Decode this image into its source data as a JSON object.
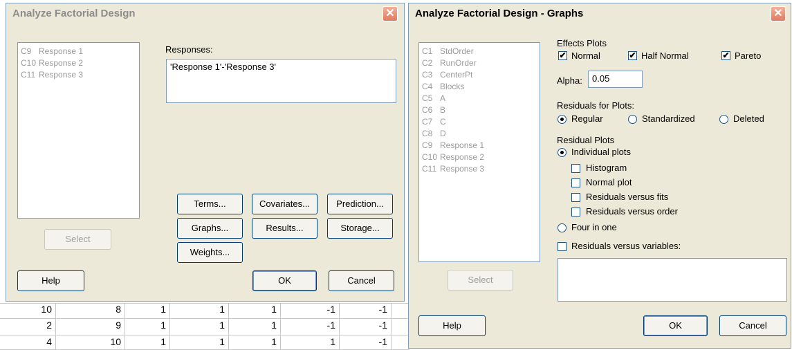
{
  "background_grid": {
    "rows": [
      [
        "10",
        "8",
        "1",
        "1",
        "1",
        "-1",
        "-1"
      ],
      [
        "2",
        "9",
        "1",
        "1",
        "1",
        "-1",
        "-1"
      ],
      [
        "4",
        "10",
        "1",
        "1",
        "1",
        "1",
        "-1"
      ]
    ]
  },
  "dialog1": {
    "title": "Analyze Factorial Design",
    "close_glyph": "✕",
    "columns": [
      {
        "id": "C9",
        "name": "Response 1"
      },
      {
        "id": "C10",
        "name": "Response 2"
      },
      {
        "id": "C11",
        "name": "Response 3"
      }
    ],
    "responses_label": "Responses:",
    "responses_value": "'Response 1'-'Response 3'",
    "select_label": "Select",
    "buttons": {
      "terms": "Terms...",
      "covariates": "Covariates...",
      "prediction": "Prediction...",
      "graphs": "Graphs...",
      "results": "Results...",
      "storage": "Storage...",
      "weights": "Weights...",
      "help": "Help",
      "ok": "OK",
      "cancel": "Cancel"
    }
  },
  "dialog2": {
    "title": "Analyze Factorial Design - Graphs",
    "close_glyph": "✕",
    "columns": [
      {
        "id": "C1",
        "name": "StdOrder"
      },
      {
        "id": "C2",
        "name": "RunOrder"
      },
      {
        "id": "C3",
        "name": "CenterPt"
      },
      {
        "id": "C4",
        "name": "Blocks"
      },
      {
        "id": "C5",
        "name": "A"
      },
      {
        "id": "C6",
        "name": "B"
      },
      {
        "id": "C7",
        "name": "C"
      },
      {
        "id": "C8",
        "name": "D"
      },
      {
        "id": "C9",
        "name": "Response 1"
      },
      {
        "id": "C10",
        "name": "Response 2"
      },
      {
        "id": "C11",
        "name": "Response 3"
      }
    ],
    "effects_plots_label": "Effects Plots",
    "normal_label": "Normal",
    "normal_checked": true,
    "half_normal_label": "Half Normal",
    "half_normal_checked": true,
    "pareto_label": "Pareto",
    "pareto_checked": true,
    "alpha_label": "Alpha:",
    "alpha_value": "0.05",
    "residuals_for_plots_label": "Residuals for Plots:",
    "regular_label": "Regular",
    "standardized_label": "Standardized",
    "deleted_label": "Deleted",
    "residual_type_selected": "Regular",
    "residual_plots_label": "Residual Plots",
    "individual_plots_label": "Individual plots",
    "histogram_label": "Histogram",
    "normal_plot_label": "Normal plot",
    "resid_vs_fits_label": "Residuals versus fits",
    "resid_vs_order_label": "Residuals versus order",
    "four_in_one_label": "Four in one",
    "residual_plot_mode_selected": "Individual plots",
    "resid_vs_variables_label": "Residuals versus variables:",
    "check_glyph": "✔",
    "select_label": "Select",
    "help_label": "Help",
    "ok_label": "OK",
    "cancel_label": "Cancel"
  }
}
